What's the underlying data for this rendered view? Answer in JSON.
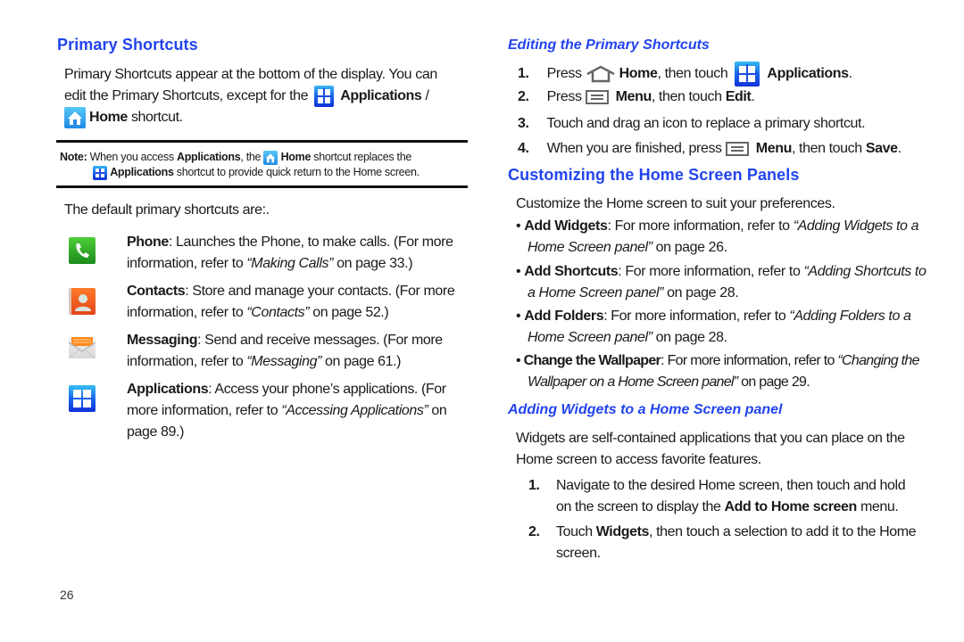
{
  "left": {
    "title": "Primary Shortcuts",
    "intro_line1": "Primary Shortcuts appear at the bottom of the display. You can",
    "intro_line2_pre": "edit the Primary Shortcuts, except for the",
    "intro_line2_bold": "Applications",
    "intro_line2_post": " /",
    "intro_line3_bold": "Home",
    "intro_line3_post": " shortcut.",
    "note": {
      "label": "Note:",
      "line1_a": " When you access ",
      "line1_b": "Applications",
      "line1_c": ", the ",
      "line1_d": "Home",
      "line1_e": " shortcut replaces the",
      "line2_a": "Applications",
      "line2_b": " shortcut to provide quick return to the Home screen."
    },
    "default_label": "The default primary shortcuts are:.",
    "shortcuts": [
      {
        "icon": "phone-icon",
        "name": "Phone",
        "line1": ": Launches the Phone, to make calls. (For more",
        "line2_pre": "information, refer to ",
        "ref": "“Making Calls”",
        "line2_post": " on page 33.)",
        "line3": ""
      },
      {
        "icon": "contacts-icon",
        "name": "Contacts",
        "line1": ": Store and manage your contacts. (For more",
        "line2_pre": "information, refer to ",
        "ref": "“Contacts”",
        "line2_post": " on page 52.)",
        "line3": ""
      },
      {
        "icon": "messaging-icon",
        "name": "Messaging",
        "line1": ": Send and receive messages. (For more",
        "line2_pre": "information, refer to ",
        "ref": "“Messaging”",
        "line2_post": " on page 61.)",
        "line3": ""
      },
      {
        "icon": "applications-icon",
        "name": "Applications",
        "line1": ": Access your phone’s applications. (For",
        "line2_pre": "more information, refer to ",
        "ref": "“Accessing Applications”",
        "line2_post": " on",
        "line3": "page 89.)"
      }
    ],
    "page_number": "26"
  },
  "right": {
    "editing": {
      "title": "Editing the Primary Shortcuts",
      "steps": [
        {
          "num": "1.",
          "a": "Press ",
          "b": "Home",
          "c": ", then touch ",
          "d": "Applications",
          "e": "."
        },
        {
          "num": "2.",
          "a": "Press ",
          "b": "Menu",
          "c": ", then touch ",
          "d": "Edit",
          "e": "."
        },
        {
          "num": "3.",
          "a": "Touch and drag an icon to replace a primary shortcut."
        },
        {
          "num": "4.",
          "a": "When you are finished, press ",
          "b": "Menu",
          "c": ", then touch ",
          "d": "Save",
          "e": "."
        }
      ]
    },
    "customizing": {
      "title": "Customizing the Home Screen Panels",
      "intro": "Customize the Home screen to suit your preferences.",
      "bullets": [
        {
          "bold": "Add Widgets",
          "text": ": For more information, refer to ",
          "ref1": "“Adding Widgets to a",
          "ref2": "Home Screen panel”",
          "post": " on page 26."
        },
        {
          "bold": "Add Shortcuts",
          "text": ": For more information, refer to ",
          "ref1": "“Adding Shortcuts to",
          "ref2": "a Home Screen panel”",
          "post": " on page 28."
        },
        {
          "bold": "Add Folders",
          "text": ": For more information, refer to ",
          "ref1": "“Adding Folders to a",
          "ref2": "Home Screen panel”",
          "post": " on page 28."
        },
        {
          "bold": "Change the Wallpaper",
          "text": ": For more information, refer to ",
          "ref1": "“Changing the",
          "ref2": "Wallpaper on a Home Screen panel”",
          "post": " on page 29."
        }
      ]
    },
    "adding": {
      "title": "Adding Widgets to a Home Screen panel",
      "intro1": "Widgets are self-contained applications that you can place on the",
      "intro2": "Home screen to access favorite features.",
      "steps": [
        {
          "num": "1.",
          "l1": "Navigate to the desired Home screen, then touch and hold",
          "l2a": "on the screen to display the ",
          "l2b": "Add to Home screen",
          "l2c": " menu."
        },
        {
          "num": "2.",
          "l1a": "Touch ",
          "l1b": "Widgets",
          "l1c": ", then touch a selection to add it to the Home",
          "l2": "screen."
        }
      ]
    }
  }
}
